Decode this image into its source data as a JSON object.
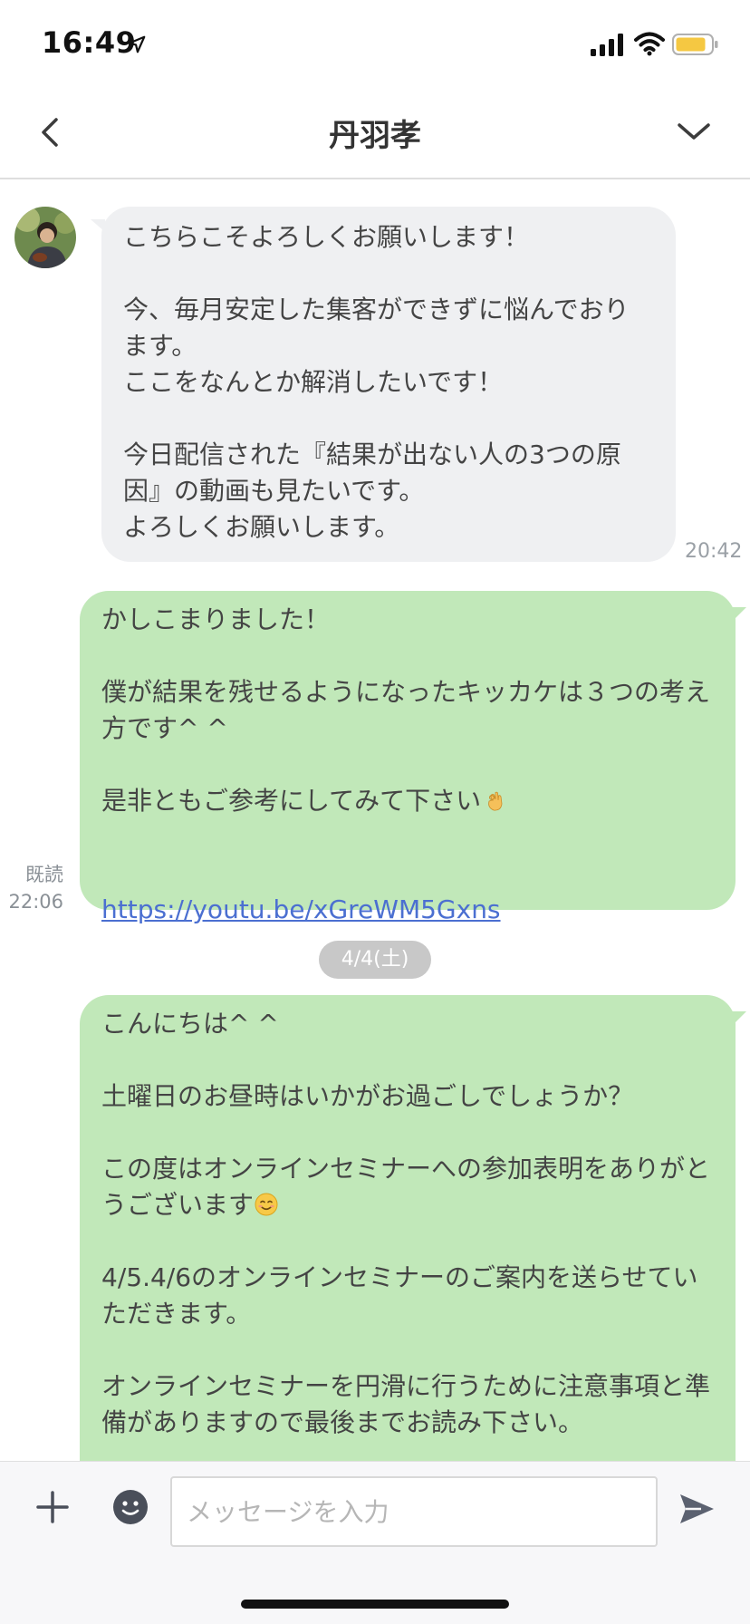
{
  "status_bar": {
    "time": "16:49",
    "location_icon": "location-arrow-icon",
    "signal_icon": "cellular-signal-icon",
    "wifi_icon": "wifi-icon",
    "battery_icon": "battery-icon",
    "battery_color": "#f5c842"
  },
  "header": {
    "title": "丹羽孝",
    "back_icon": "chevron-left-icon",
    "menu_icon": "chevron-down-icon"
  },
  "messages": [
    {
      "direction": "incoming",
      "text": "こちらこそよろしくお願いします！\n\n今、毎月安定した集客ができずに悩んでおります。\nここをなんとか解消したいです！\n\n今日配信された『結果が出ない人の3つの原因』の動画も見たいです。\nよろしくお願いします。",
      "time": "20:42"
    },
    {
      "direction": "outgoing",
      "text_before_emoji": "かしこまりました！\n\n僕が結果を残せるようになったキッカケは３つの考え方です^ ^\n\n是非ともご参考にしてみて下さい",
      "emoji": "ok-hand-emoji",
      "link": "https://youtu.be/xGreWM5Gxns",
      "read_label": "既読",
      "time": "22:06"
    },
    {
      "direction": "outgoing",
      "text_a": "こんにちは^ ^\n\n土曜日のお昼時はいかがお過ごしでしょうか？\n\nこの度はオンラインセミナーへの参加表明をありがとうございます",
      "emoji": "smiling-face-emoji",
      "text_b": "\n\n4/5.4/6のオンラインセミナーのご案内を送らせていただきます。\n\nオンラインセミナーを円滑に行うために注意事項と準備がありますので最後までお読み下さい。"
    }
  ],
  "date_separator": "4/4(土)",
  "input_bar": {
    "placeholder": "メッセージを入力",
    "plus_icon": "plus-icon",
    "sticker_icon": "smiley-icon",
    "send_icon": "send-icon"
  },
  "colors": {
    "incoming_bubble": "#eff0f2",
    "outgoing_bubble": "#c1e8b9",
    "link": "#4b6fd1"
  }
}
